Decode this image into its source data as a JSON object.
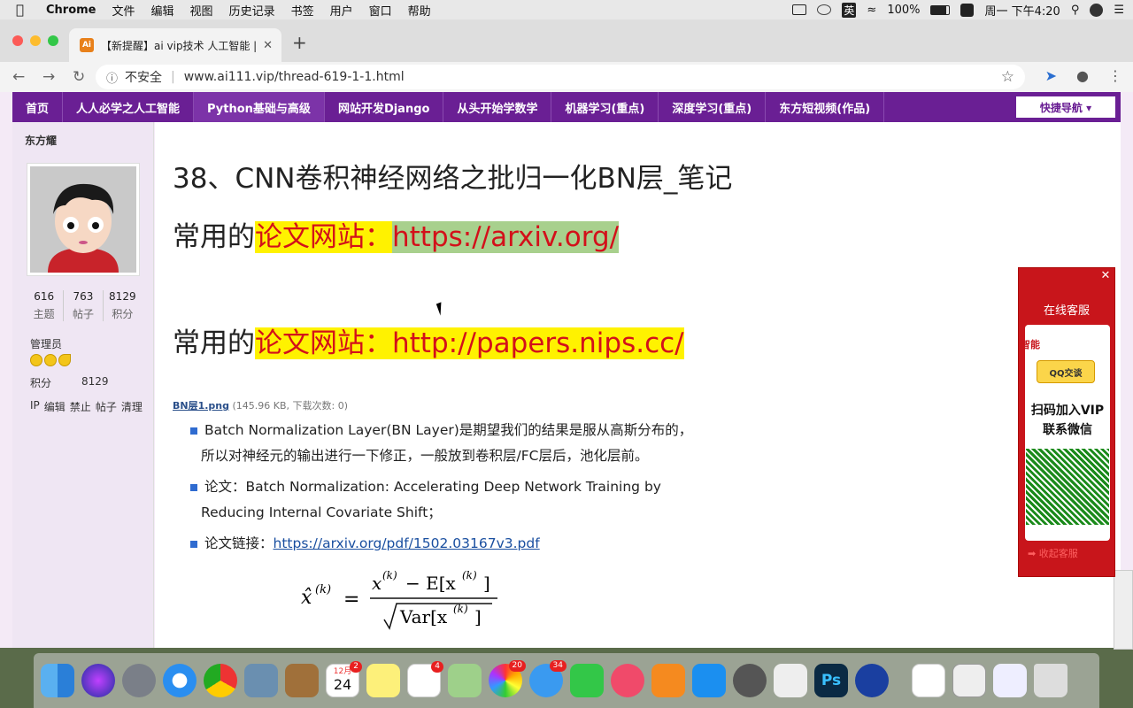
{
  "menubar": {
    "app": "Chrome",
    "items": [
      "文件",
      "编辑",
      "视图",
      "历史记录",
      "书签",
      "用户",
      "窗口",
      "帮助"
    ],
    "ime": "英",
    "battery": "100%",
    "clock": "周一 下午4:20"
  },
  "browser": {
    "tab_title": "【新提醒】ai vip技术 人工智能 |",
    "favicon": "Ai",
    "security": "不安全",
    "url": "www.ai111.vip/thread-619-1-1.html"
  },
  "sitenav": {
    "items": [
      "首页",
      "人人必学之人工智能",
      "Python基础与高级",
      "网站开发Django",
      "从头开始学数学",
      "机器学习(重点)",
      "深度学习(重点)",
      "东方短视频(作品)"
    ],
    "quick": "快捷导航 ▾"
  },
  "sidebar": {
    "username": "东方耀",
    "stats": [
      {
        "num": "616",
        "label": "主题"
      },
      {
        "num": "763",
        "label": "帖子"
      },
      {
        "num": "8129",
        "label": "积分"
      }
    ],
    "role": "管理员",
    "points_label": "积分",
    "points_value": "8129",
    "actions": [
      "IP",
      "编辑",
      "禁止",
      "帖子",
      "清理"
    ]
  },
  "post": {
    "title": "38、CNN卷积神经网络之批归一化BN层_笔记",
    "line1_prefix": "常用的",
    "line1_label": "论文网站：",
    "line1_url": "https://arxiv.org/",
    "line2_prefix": "常用的",
    "line2_label": "论文网站：",
    "line2_url": "http://papers.nips.cc/",
    "attachment_name": "BN层1.png",
    "attachment_meta": "(145.96 KB, 下载次数: 0)",
    "bullet1a": "Batch Normalization Layer(BN Layer)是期望我们的结果是服从高斯分布的，",
    "bullet1b": "所以对神经元的输出进行一下修正，一般放到卷积层/FC层后，池化层前。",
    "bullet2a": "论文：Batch Normalization: Accelerating Deep Network Training by",
    "bullet2b": "Reducing Internal Covariate Shift；",
    "bullet3_label": "论文链接：",
    "bullet3_url": "https://arxiv.org/pdf/1502.03167v3.pdf"
  },
  "ad": {
    "header": "在线客服",
    "fragment": "智能",
    "qq": "QQ交谈",
    "vip_line1": "扫码加入VIP",
    "vip_line2": "联系微信",
    "footer": "➡ 收起客服"
  },
  "dock": {
    "calendar_month": "12月",
    "calendar_day": "24",
    "badges": {
      "calendar": "2",
      "reminders": "4",
      "photos": "20",
      "messages": "34"
    }
  }
}
